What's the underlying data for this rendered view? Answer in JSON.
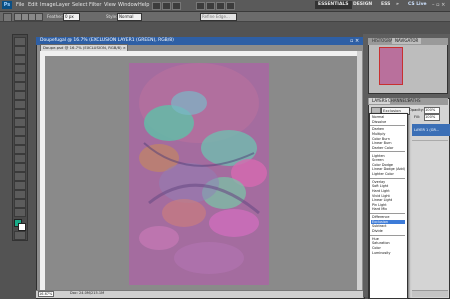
{
  "app": {
    "logo": "Ps"
  },
  "menu": [
    "File",
    "Edit",
    "Image",
    "Layer",
    "Select",
    "Filter",
    "View",
    "Window",
    "Help"
  ],
  "workspace": {
    "active": "ESSENTIALS",
    "design": "DESIGN",
    "ess": "ESS",
    "more": "»",
    "cs_live": "CS Live"
  },
  "options": {
    "feather_label": "Feather:",
    "feather_value": "0 px",
    "style_label": "Style:",
    "style_value": "Normal",
    "refine_edge": "Refine Edge..."
  },
  "document": {
    "title": "Doupefugal @ 16.7% (EXCLUSION LAYER1 (GREEN), RGB/8)",
    "tab2": "Doupe.psd @ 16.7% (EXCLUSION, RGB/8) ×",
    "zoom": "16.67%",
    "doc_size": "Doc: 24.0M/215.1M"
  },
  "navigator": {
    "tabs": [
      "HISTOGRAM",
      "NAVIGATOR"
    ]
  },
  "layers": {
    "tabs": [
      "LAYERS",
      "CHANNELS",
      "PATHS"
    ],
    "blend_mode": "Exclusion",
    "opacity_label": "Opacity:",
    "opacity_value": "100%",
    "fill_label": "Fill:",
    "fill_value": "100%",
    "layer_name": "LAYER 1 (GR..."
  },
  "blend_menu": {
    "groups": [
      [
        "Normal",
        "Dissolve"
      ],
      [
        "Darken",
        "Multiply",
        "Color Burn",
        "Linear Burn",
        "Darker Color"
      ],
      [
        "Lighten",
        "Screen",
        "Color Dodge",
        "Linear Dodge (Add)",
        "Lighter Color"
      ],
      [
        "Overlay",
        "Soft Light",
        "Hard Light",
        "Vivid Light",
        "Linear Light",
        "Pin Light",
        "Hard Mix"
      ],
      [
        "Difference",
        "Exclusion",
        "Subtract",
        "Divide"
      ],
      [
        "Hue",
        "Saturation",
        "Color",
        "Luminosity"
      ]
    ],
    "selected": "Exclusion"
  }
}
